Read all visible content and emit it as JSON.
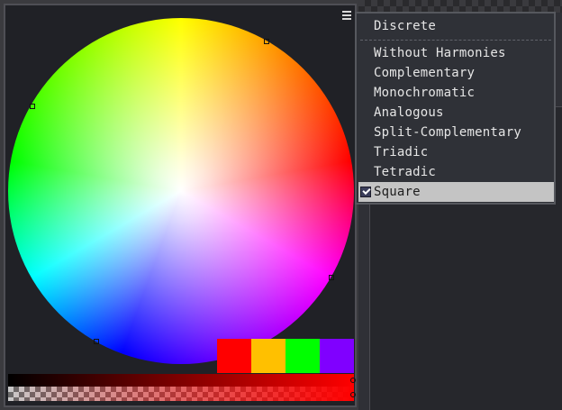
{
  "palette": {
    "swatches": [
      "#ff0000",
      "#ffc000",
      "#00ff00",
      "#8000ff"
    ],
    "current_color": "#ff0000"
  },
  "menu": {
    "icon": "hamburger-menu-icon",
    "items": [
      {
        "label": "Discrete"
      },
      {
        "label": "Without Harmonies"
      },
      {
        "label": "Complementary"
      },
      {
        "label": "Monochromatic"
      },
      {
        "label": "Analogous"
      },
      {
        "label": "Split-Complementary"
      },
      {
        "label": "Triadic"
      },
      {
        "label": "Tetradic"
      },
      {
        "label": "Square",
        "selected": true
      }
    ]
  }
}
